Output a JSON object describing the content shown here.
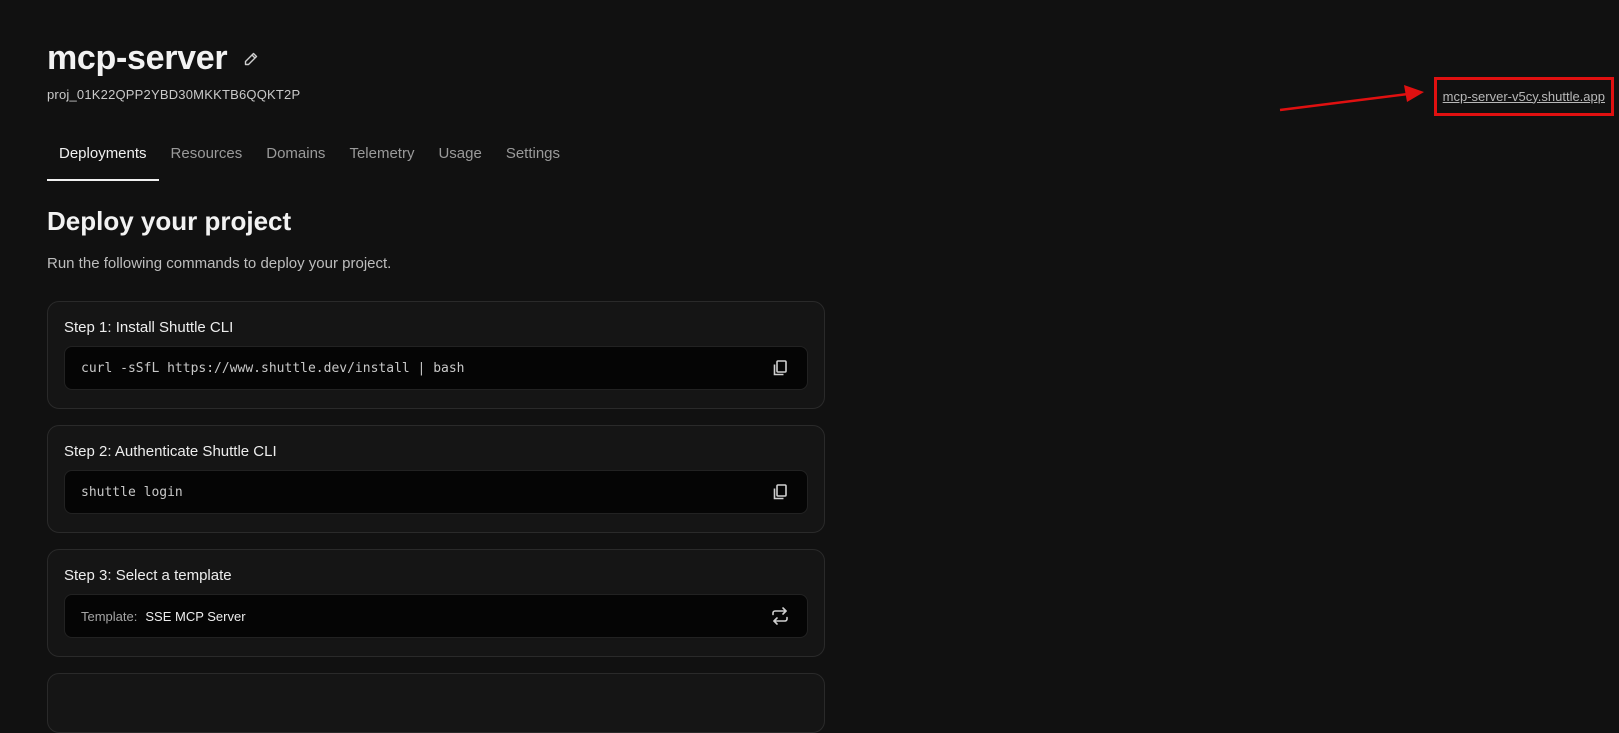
{
  "project": {
    "name": "mcp-server",
    "id": "proj_01K22QPP2YBD30MKKTB6QQKT2P",
    "url": "mcp-server-v5cy.shuttle.app"
  },
  "tabs": [
    {
      "label": "Deployments",
      "active": true
    },
    {
      "label": "Resources",
      "active": false
    },
    {
      "label": "Domains",
      "active": false
    },
    {
      "label": "Telemetry",
      "active": false
    },
    {
      "label": "Usage",
      "active": false
    },
    {
      "label": "Settings",
      "active": false
    }
  ],
  "deploy": {
    "title": "Deploy your project",
    "description": "Run the following commands to deploy your project.",
    "steps": [
      {
        "title": "Step 1: Install Shuttle CLI",
        "command": "curl -sSfL https://www.shuttle.dev/install | bash",
        "action_icon": "copy-icon"
      },
      {
        "title": "Step 2: Authenticate Shuttle CLI",
        "command": "shuttle login",
        "action_icon": "copy-icon"
      },
      {
        "title": "Step 3: Select a template",
        "template_label": "Template:",
        "template_value": "SSE MCP Server",
        "action_icon": "swap-icon"
      }
    ]
  },
  "colors": {
    "background": "#111111",
    "card": "#151515",
    "annotation": "#e01010"
  }
}
